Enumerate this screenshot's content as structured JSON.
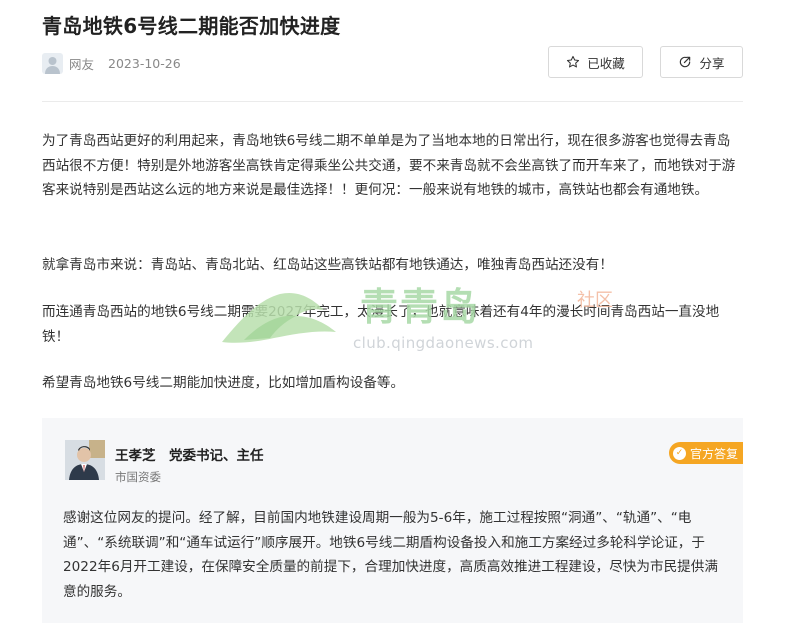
{
  "article": {
    "title": "青岛地铁6号线二期能否加快进度",
    "author": "网友",
    "date": "2023-10-26",
    "favorite_label": "已收藏",
    "share_label": "分享",
    "paragraphs": [
      "为了青岛西站更好的利用起来，青岛地铁6号线二期不单单是为了当地本地的日常出行，现在很多游客也觉得去青岛西站很不方便！特别是外地游客坐高铁肯定得乘坐公共交通，要不来青岛就不会坐高铁了而开车来了，而地铁对于游客来说特别是西站这么远的地方来说是最佳选择！！更何况：一般来说有地铁的城市，高铁站也都会有通地铁。",
      "就拿青岛市来说：青岛站、青岛北站、红岛站这些高铁站都有地铁通达，唯独青岛西站还没有！",
      "而连通青岛西站的地铁6号线二期需要2027年完工，太漫长了，也就意味着还有4年的漫长时间青岛西站一直没地铁！",
      "希望青岛地铁6号线二期能加快进度，比如增加盾构设备等。"
    ]
  },
  "watermark": {
    "brand": "青青岛",
    "sub": "社区",
    "url": "club.qingdaonews.com"
  },
  "answer": {
    "responder": "王孝芝　党委书记、主任",
    "department": "市国资委",
    "badge": "官方答复",
    "text": "感谢这位网友的提问。经了解，目前国内地铁建设周期一般为5-6年，施工过程按照“洞通”、“轨通”、“电通”、“系统联调”和“通车试运行”顺序展开。地铁6号线二期盾构设备投入和施工方案经过多轮科学论证，于2022年6月开工建设，在保障安全质量的前提下，合理加快进度，高质高效推进工程建设，尽快为市民提供满意的服务。"
  },
  "colors": {
    "badge": "#f5a623",
    "answer_bg": "#f6f7f9",
    "watermark_green": "#a8d9a6",
    "watermark_orange": "#f3b69a"
  },
  "icons": {
    "favorite": "star-icon",
    "share": "share-icon",
    "badge": "check-circle-icon",
    "author": "user-avatar-icon"
  }
}
